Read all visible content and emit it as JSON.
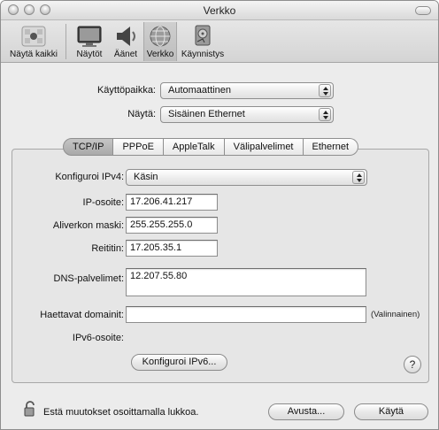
{
  "window": {
    "title": "Verkko"
  },
  "toolbar": {
    "items": [
      {
        "label": "Näytä kaikki",
        "icon": "apple-grid-icon"
      },
      {
        "label": "Näytöt",
        "icon": "display-icon"
      },
      {
        "label": "Äänet",
        "icon": "speaker-icon"
      },
      {
        "label": "Verkko",
        "icon": "globe-icon",
        "selected": true
      },
      {
        "label": "Käynnistys",
        "icon": "startup-disk-icon"
      }
    ]
  },
  "location": {
    "label": "Käyttöpaikka:",
    "value": "Automaattinen"
  },
  "show": {
    "label": "Näytä:",
    "value": "Sisäinen Ethernet"
  },
  "tabs": [
    {
      "label": "TCP/IP",
      "active": true
    },
    {
      "label": "PPPoE"
    },
    {
      "label": "AppleTalk"
    },
    {
      "label": "Välipalvelimet"
    },
    {
      "label": "Ethernet"
    }
  ],
  "tcpip": {
    "configure_ipv4_label": "Konfiguroi IPv4:",
    "configure_ipv4_value": "Käsin",
    "ip_label": "IP-osoite:",
    "ip_value": "17.206.41.217",
    "subnet_label": "Aliverkon maski:",
    "subnet_value": "255.255.255.0",
    "router_label": "Reititin:",
    "router_value": "17.205.35.1",
    "dns_label": "DNS-palvelimet:",
    "dns_value": "12.207.55.80",
    "search_label": "Haettavat domainit:",
    "search_value": "",
    "optional_note": "(Valinnainen)",
    "ipv6_label": "IPv6-osoite:",
    "configure_ipv6_button": "Konfiguroi IPv6...",
    "help_symbol": "?"
  },
  "footer": {
    "lock_text": "Estä muutokset osoittamalla lukkoa.",
    "assist_button": "Avusta...",
    "apply_button": "Käytä"
  }
}
